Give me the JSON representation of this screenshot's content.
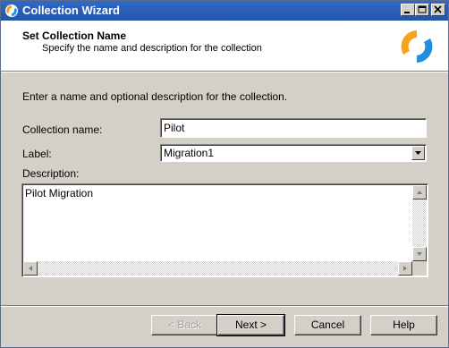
{
  "window": {
    "title": "Collection Wizard",
    "icon": "wizard-logo-icon",
    "controls": {
      "minimize": "minimize-icon",
      "maximize": "maximize-icon",
      "close": "close-icon"
    }
  },
  "header": {
    "title": "Set Collection Name",
    "subtitle": "Specify the name and description for the collection",
    "logo": "wizard-logo-icon",
    "logo_colors": {
      "orange": "#f7a21b",
      "blue": "#1f8ee0"
    }
  },
  "form": {
    "instruction": "Enter a name and optional description for the collection.",
    "name_label": "Collection name:",
    "name_value": "Pilot",
    "label_label": "Label:",
    "label_value": "Migration1",
    "description_label": "Description:",
    "description_value": "Pilot Migration"
  },
  "buttons": {
    "back": "< Back",
    "next": "Next >",
    "cancel": "Cancel",
    "help": "Help"
  },
  "colors": {
    "titlebar": "#2a5fb8",
    "dialog_face": "#d4d0c8"
  }
}
